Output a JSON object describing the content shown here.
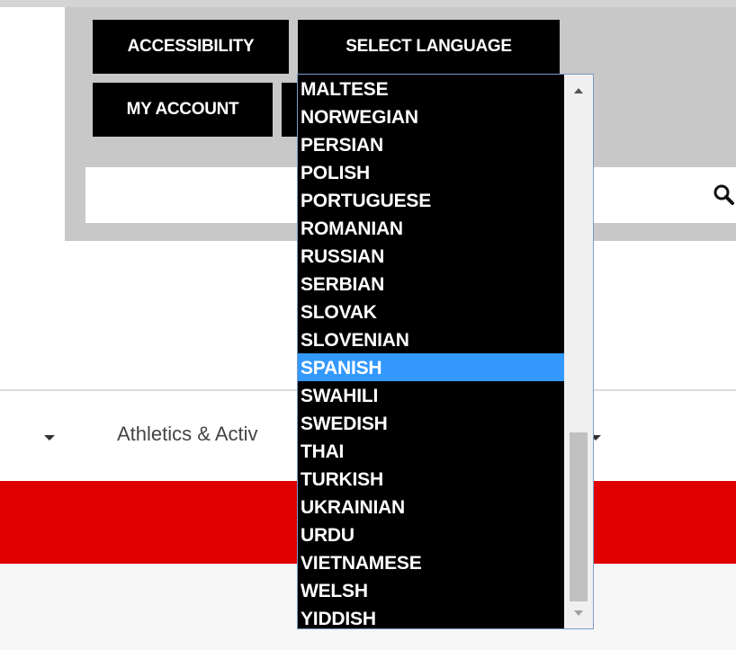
{
  "header": {
    "accessibility_label": "ACCESSIBILITY",
    "select_language_label": "SELECT LANGUAGE",
    "my_account_label": "MY ACCOUNT"
  },
  "search": {
    "placeholder": "",
    "value": ""
  },
  "nav": {
    "athletics_label": "Athletics & Activ"
  },
  "language_dropdown": {
    "options": [
      "MALTESE",
      "NORWEGIAN",
      "PERSIAN",
      "POLISH",
      "PORTUGUESE",
      "ROMANIAN",
      "RUSSIAN",
      "SERBIAN",
      "SLOVAK",
      "SLOVENIAN",
      "SPANISH",
      "SWAHILI",
      "SWEDISH",
      "THAI",
      "TURKISH",
      "UKRAINIAN",
      "URDU",
      "VIETNAMESE",
      "WELSH",
      "YIDDISH"
    ],
    "selected": "SPANISH"
  },
  "colors": {
    "button_bg": "#000000",
    "highlight": "#3399ff",
    "red_band": "#e00000",
    "header_bg": "#c8c8c8"
  },
  "icons": [
    "search-icon",
    "chevron-down-icon",
    "scroll-up-arrow-icon",
    "scroll-down-arrow-icon"
  ]
}
